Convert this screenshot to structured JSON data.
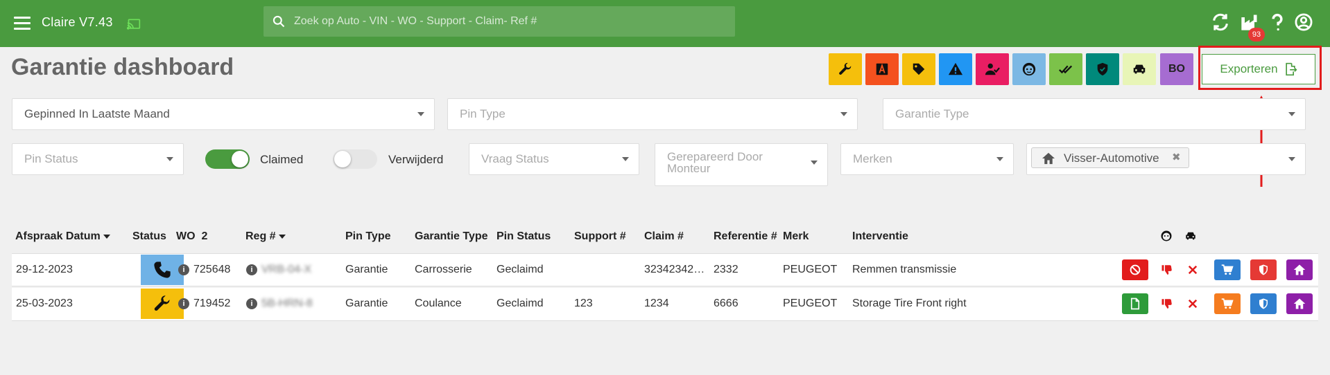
{
  "app": {
    "title": "Claire V7.43",
    "notification_count": "93"
  },
  "search": {
    "placeholder": "Zoek op Auto - VIN - WO - Support - Claim- Ref #"
  },
  "page": {
    "title": "Garantie dashboard"
  },
  "filter_buttons": [
    {
      "icon": "wrench-icon",
      "color": "#f5bf0c"
    },
    {
      "icon": "letter-a-icon",
      "color": "#f4511e"
    },
    {
      "icon": "tag-icon",
      "color": "#f5bf0c"
    },
    {
      "icon": "warning-icon",
      "color": "#2196f3"
    },
    {
      "icon": "user-check-icon",
      "color": "#e91e63"
    },
    {
      "icon": "face-icon",
      "color": "#7cb8e4"
    },
    {
      "icon": "double-check-icon",
      "color": "#7cc24a"
    },
    {
      "icon": "shield-check-icon",
      "color": "#00897b"
    },
    {
      "icon": "car-icon",
      "color": "#e8f5b7"
    },
    {
      "icon": "bo-icon",
      "label": "BO",
      "color": "#a66cd1"
    }
  ],
  "export": {
    "label": "Exporteren"
  },
  "filters": {
    "pinned": {
      "value": "Gepinned In Laatste Maand"
    },
    "pin_type": {
      "placeholder": "Pin Type"
    },
    "garantie_type": {
      "placeholder": "Garantie Type"
    },
    "pin_status": {
      "placeholder": "Pin Status"
    },
    "claimed": {
      "label": "Claimed",
      "on": true
    },
    "verwijderd": {
      "label": "Verwijderd",
      "on": false
    },
    "vraag_status": {
      "placeholder": "Vraag Status"
    },
    "gerepareerd": {
      "placeholder_line1": "Gerepareerd Door",
      "placeholder_line2": "Monteur"
    },
    "merken": {
      "placeholder": "Merken"
    },
    "dealer": {
      "chip": "Visser-Automotive"
    }
  },
  "table": {
    "headers": {
      "afspraak": "Afspraak Datum",
      "status": "Status",
      "wo": "WO",
      "wo_count": "2",
      "reg": "Reg #",
      "pin_type": "Pin Type",
      "garantie_type": "Garantie Type",
      "pin_status": "Pin Status",
      "support": "Support #",
      "claim": "Claim #",
      "referentie": "Referentie #",
      "merk": "Merk",
      "interventie": "Interventie"
    },
    "rows": [
      {
        "date": "29-12-2023",
        "status_icon": "phone-icon",
        "status_color": "#6fb2e6",
        "wo": "725648",
        "reg": "VRB-04-X",
        "pin_type": "Garantie",
        "garantie_type": "Carrosserie",
        "pin_status": "Geclaimd",
        "support": "",
        "claim": "32342342…",
        "referentie": "2332",
        "merk": "PEUGEOT",
        "interventie": "Remmen transmissie",
        "first_action": "ban-icon",
        "first_action_color": "#e21c1c",
        "cart_color": "#2f7fd0",
        "shield_color": "#e53935"
      },
      {
        "date": "25-03-2023",
        "status_icon": "wrench-icon",
        "status_color": "#f5bf0c",
        "wo": "719452",
        "reg": "5B-HRN-8",
        "pin_type": "Garantie",
        "garantie_type": "Coulance",
        "pin_status": "Geclaimd",
        "support": "123",
        "claim": "1234",
        "referentie": "6666",
        "merk": "PEUGEOT",
        "interventie": "Storage Tire Front right",
        "first_action": "file-icon",
        "first_action_color": "#2e9b3a",
        "cart_color": "#f57c1f",
        "shield_color": "#2f7fd0"
      }
    ]
  }
}
